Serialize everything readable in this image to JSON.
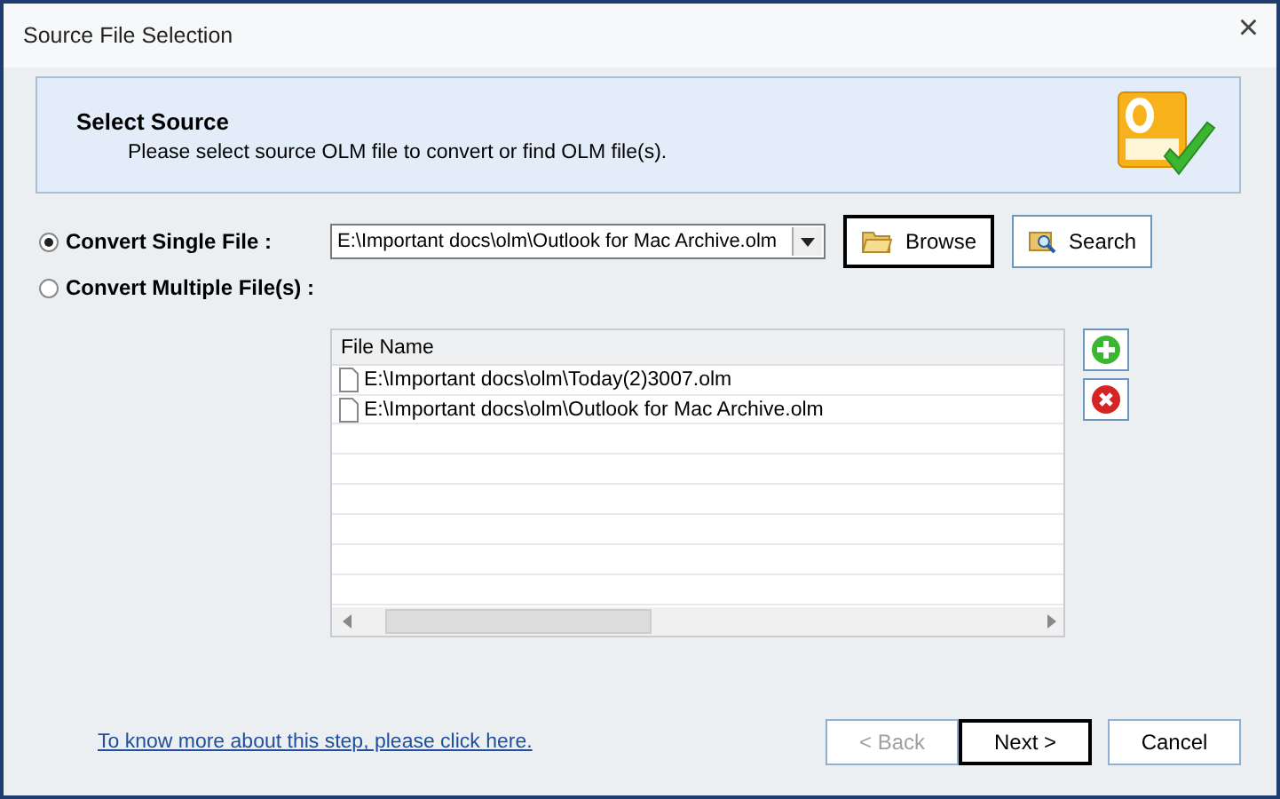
{
  "window": {
    "title": "Source File Selection",
    "close": "×"
  },
  "header": {
    "title": "Select Source",
    "description": "Please select source OLM file to convert or find OLM file(s)."
  },
  "options": [
    {
      "label": "Convert Single File :",
      "selected": true
    },
    {
      "label": "Convert Multiple File(s) :",
      "selected": false
    }
  ],
  "file_combo": {
    "value": "E:\\Important docs\\olm\\Outlook for Mac Archive.olm"
  },
  "browse_button": "Browse",
  "search_button": "Search",
  "file_list": {
    "columns": [
      "File Name"
    ],
    "rows": [
      "E:\\Important docs\\olm\\Today(2)3007.olm",
      "E:\\Important docs\\olm\\Outlook for Mac Archive.olm"
    ]
  },
  "help_link": "To know more about this step, please click here.",
  "buttons": [
    {
      "label": "< Back",
      "disabled": true,
      "default": false
    },
    {
      "label": "Next >",
      "disabled": false,
      "default": true
    },
    {
      "label": "Cancel",
      "disabled": false,
      "default": false
    }
  ]
}
